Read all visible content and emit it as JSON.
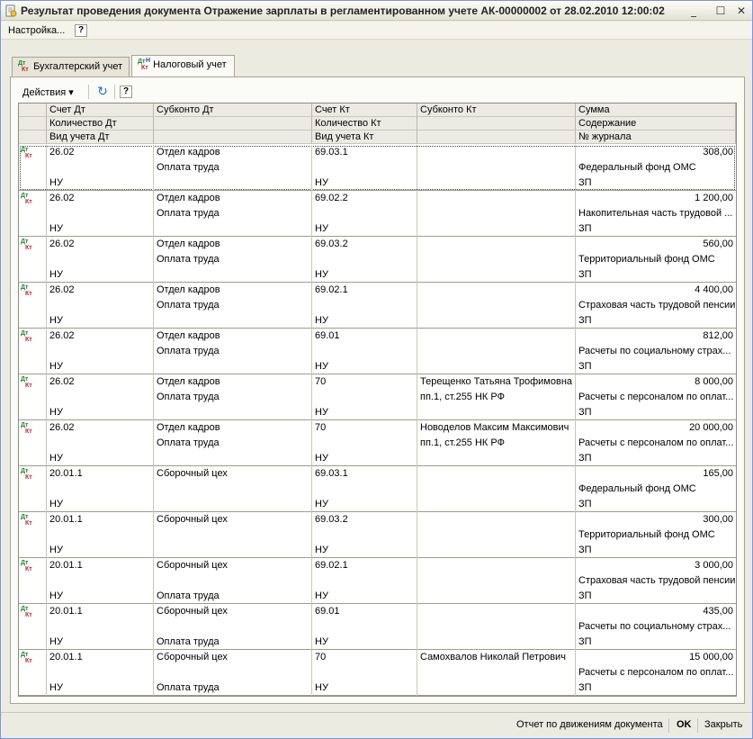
{
  "window": {
    "title": "Результат проведения документа Отражение зарплаты в регламентированном учете АК-00000002 от 28.02.2010 12:00:02",
    "minimize": "_",
    "maximize": "☐",
    "close": "✕"
  },
  "menubar": {
    "settings": "Настройка...",
    "help": "?"
  },
  "tabs": [
    {
      "label": "Бухгалтерский учет",
      "active": false
    },
    {
      "label": "Налоговый учет",
      "active": true
    }
  ],
  "toolbar": {
    "actions": "Действия ▾",
    "refresh": "↻",
    "help": "?"
  },
  "columns": {
    "c1": [
      "Счет Дт",
      "Количество Дт",
      "Вид учета Дт"
    ],
    "c2": [
      "Субконто Дт",
      "",
      ""
    ],
    "c3": [
      "Счет Кт",
      "Количество Кт",
      "Вид учета Кт"
    ],
    "c4": [
      "Субконто Кт",
      "",
      ""
    ],
    "c5": [
      "Сумма",
      "Содержание",
      "№ журнала"
    ]
  },
  "rows": [
    {
      "acc_dt": "26.02",
      "sub_dt1": "Отдел кадров",
      "sub_dt2": "Оплата труда",
      "vid_dt": "НУ",
      "acc_kt": "69.03.1",
      "sub_kt1": "",
      "sub_kt2": "",
      "vid_kt": "НУ",
      "sum": "308,00",
      "content": "Федеральный фонд ОМС",
      "journal": "ЗП",
      "sub_dt3": ""
    },
    {
      "acc_dt": "26.02",
      "sub_dt1": "Отдел кадров",
      "sub_dt2": "Оплата труда",
      "vid_dt": "НУ",
      "acc_kt": "69.02.2",
      "sub_kt1": "",
      "sub_kt2": "",
      "vid_kt": "НУ",
      "sum": "1 200,00",
      "content": "Накопительная часть трудовой ...",
      "journal": "ЗП",
      "sub_dt3": ""
    },
    {
      "acc_dt": "26.02",
      "sub_dt1": "Отдел кадров",
      "sub_dt2": "Оплата труда",
      "vid_dt": "НУ",
      "acc_kt": "69.03.2",
      "sub_kt1": "",
      "sub_kt2": "",
      "vid_kt": "НУ",
      "sum": "560,00",
      "content": "Территориальный фонд ОМС",
      "journal": "ЗП",
      "sub_dt3": ""
    },
    {
      "acc_dt": "26.02",
      "sub_dt1": "Отдел кадров",
      "sub_dt2": "Оплата труда",
      "vid_dt": "НУ",
      "acc_kt": "69.02.1",
      "sub_kt1": "",
      "sub_kt2": "",
      "vid_kt": "НУ",
      "sum": "4 400,00",
      "content": "Страховая часть трудовой пенсии",
      "journal": "ЗП",
      "sub_dt3": ""
    },
    {
      "acc_dt": "26.02",
      "sub_dt1": "Отдел кадров",
      "sub_dt2": "Оплата труда",
      "vid_dt": "НУ",
      "acc_kt": "69.01",
      "sub_kt1": "",
      "sub_kt2": "",
      "vid_kt": "НУ",
      "sum": "812,00",
      "content": "Расчеты по социальному страх...",
      "journal": "ЗП",
      "sub_dt3": ""
    },
    {
      "acc_dt": "26.02",
      "sub_dt1": "Отдел кадров",
      "sub_dt2": "Оплата труда",
      "vid_dt": "НУ",
      "acc_kt": "70",
      "sub_kt1": "Терещенко Татьяна Трофимовна",
      "sub_kt2": "пп.1, ст.255 НК РФ",
      "vid_kt": "НУ",
      "sum": "8 000,00",
      "content": "Расчеты с персоналом по оплат...",
      "journal": "ЗП",
      "sub_dt3": ""
    },
    {
      "acc_dt": "26.02",
      "sub_dt1": "Отдел кадров",
      "sub_dt2": "Оплата труда",
      "vid_dt": "НУ",
      "acc_kt": "70",
      "sub_kt1": "Новоделов Максим Максимович",
      "sub_kt2": "пп.1, ст.255 НК РФ",
      "vid_kt": "НУ",
      "sum": "20 000,00",
      "content": "Расчеты с персоналом по оплат...",
      "journal": "ЗП",
      "sub_dt3": ""
    },
    {
      "acc_dt": "20.01.1",
      "sub_dt1": "Сборочный цех",
      "sub_dt2": "",
      "vid_dt": "НУ",
      "acc_kt": "69.03.1",
      "sub_kt1": "",
      "sub_kt2": "",
      "vid_kt": "НУ",
      "sum": "165,00",
      "content": "Федеральный фонд ОМС",
      "journal": "ЗП",
      "sub_dt3": ""
    },
    {
      "acc_dt": "20.01.1",
      "sub_dt1": "Сборочный цех",
      "sub_dt2": "",
      "vid_dt": "НУ",
      "acc_kt": "69.03.2",
      "sub_kt1": "",
      "sub_kt2": "",
      "vid_kt": "НУ",
      "sum": "300,00",
      "content": "Территориальный фонд ОМС",
      "journal": "ЗП",
      "sub_dt3": ""
    },
    {
      "acc_dt": "20.01.1",
      "sub_dt1": "Сборочный цех",
      "sub_dt2": "",
      "vid_dt": "НУ",
      "acc_kt": "69.02.1",
      "sub_kt1": "",
      "sub_kt2": "",
      "vid_kt": "НУ",
      "sum": "3 000,00",
      "content": "Страховая часть трудовой пенсии",
      "journal": "ЗП",
      "sub_dt3": "Оплата труда"
    },
    {
      "acc_dt": "20.01.1",
      "sub_dt1": "Сборочный цех",
      "sub_dt2": "",
      "vid_dt": "НУ",
      "acc_kt": "69.01",
      "sub_kt1": "",
      "sub_kt2": "",
      "vid_kt": "НУ",
      "sum": "435,00",
      "content": "Расчеты по социальному страх...",
      "journal": "ЗП",
      "sub_dt3": "Оплата труда"
    },
    {
      "acc_dt": "20.01.1",
      "sub_dt1": "Сборочный цех",
      "sub_dt2": "",
      "vid_dt": "НУ",
      "acc_kt": "70",
      "sub_kt1": "Самохвалов Николай Петрович",
      "sub_kt2": "",
      "vid_kt": "НУ",
      "sum": "15 000,00",
      "content": "Расчеты с персоналом по оплат...",
      "journal": "ЗП",
      "sub_dt3": "Оплата труда"
    }
  ],
  "row_icon": {
    "dt": "Дт",
    "kt": "Кт",
    "name": "dt-kt-icon"
  },
  "statusbar": {
    "report": "Отчет по движениям документа",
    "ok": "OK",
    "close": "Закрыть"
  }
}
